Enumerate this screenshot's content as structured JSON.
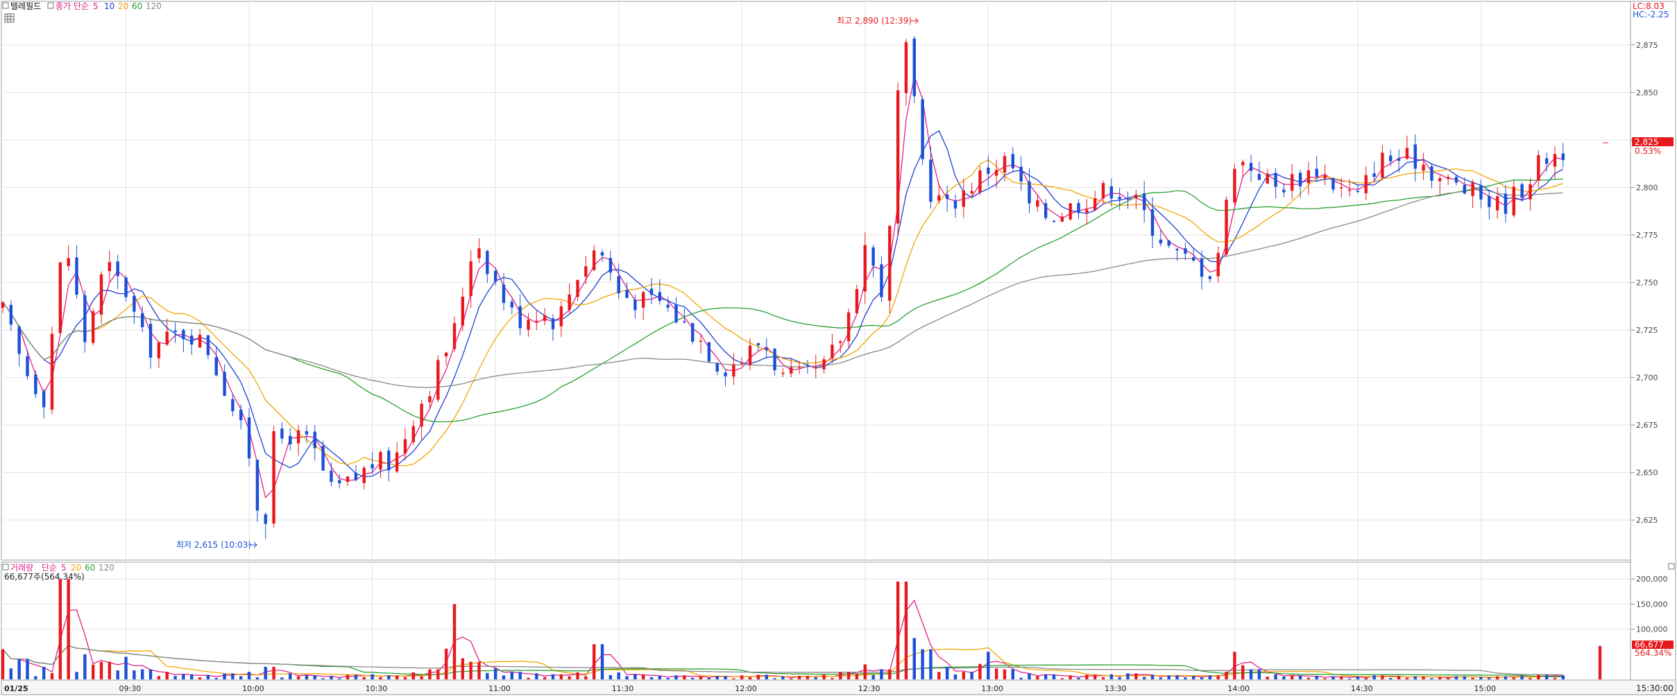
{
  "price_panel": {
    "title": "텔레필드",
    "indicator_label": "종가 단순",
    "ma_labels": [
      {
        "text": "5",
        "color": "#e0218a"
      },
      {
        "text": "10",
        "color": "#1f3fd1"
      },
      {
        "text": "20",
        "color": "#f2a500"
      },
      {
        "text": "60",
        "color": "#26a030"
      },
      {
        "text": "120",
        "color": "#888888"
      }
    ],
    "lc_label": "LC:8.03",
    "hc_label": "HC:-2.25",
    "high_annotation": "최고 2,890 (12:39)",
    "low_annotation": "최저 2,615 (10:03)",
    "current_price_tag": "2,825",
    "current_change_tag": "0.53%",
    "y_ticks": [
      "2,875",
      "2,850",
      "2,825",
      "2,800",
      "2,775",
      "2,750",
      "2,725",
      "2,700",
      "2,675",
      "2,650",
      "2,625"
    ]
  },
  "volume_panel": {
    "title": "거래량",
    "indicator_label": "단순",
    "ma_labels": [
      {
        "text": "5",
        "color": "#e0218a"
      },
      {
        "text": "20",
        "color": "#f2a500"
      },
      {
        "text": "60",
        "color": "#26a030"
      },
      {
        "text": "120",
        "color": "#888888"
      }
    ],
    "info_line": "66,677주(564.34%)",
    "current_volume_tag": "66,677",
    "current_ratio_tag": "564.34%",
    "y_ticks": [
      "200,000",
      "150,000",
      "100,000"
    ]
  },
  "x_axis": {
    "ticks": [
      "01/25",
      "09:30",
      "10:00",
      "10:30",
      "11:00",
      "11:30",
      "12:00",
      "12:30",
      "13:00",
      "13:30",
      "14:00",
      "14:30",
      "15:00"
    ],
    "end_label": "15:30:00"
  },
  "colors": {
    "up": "#e8191e",
    "down": "#1b4fd8",
    "ma5": "#e0218a",
    "ma10": "#1f3fd1",
    "ma20": "#f2a500",
    "ma60": "#26a030",
    "ma120": "#888888"
  },
  "chart_data": [
    {
      "type": "candlestick",
      "title": "텔레필드",
      "x_range": [
        "09:00",
        "15:30"
      ],
      "ylim": [
        2605,
        2895
      ],
      "grid": true,
      "price_points": [
        {
          "t": "09:00",
          "v": 2735
        },
        {
          "t": "09:05",
          "v": 2705
        },
        {
          "t": "09:10",
          "v": 2690
        },
        {
          "t": "09:15",
          "v": 2775
        },
        {
          "t": "09:20",
          "v": 2720
        },
        {
          "t": "09:25",
          "v": 2760
        },
        {
          "t": "09:30",
          "v": 2745
        },
        {
          "t": "09:35",
          "v": 2715
        },
        {
          "t": "09:40",
          "v": 2720
        },
        {
          "t": "09:45",
          "v": 2725
        },
        {
          "t": "09:50",
          "v": 2715
        },
        {
          "t": "09:55",
          "v": 2690
        },
        {
          "t": "10:00",
          "v": 2660
        },
        {
          "t": "10:03",
          "v": 2620
        },
        {
          "t": "10:05",
          "v": 2665
        },
        {
          "t": "10:10",
          "v": 2670
        },
        {
          "t": "10:15",
          "v": 2665
        },
        {
          "t": "10:20",
          "v": 2640
        },
        {
          "t": "10:25",
          "v": 2645
        },
        {
          "t": "10:30",
          "v": 2655
        },
        {
          "t": "10:35",
          "v": 2655
        },
        {
          "t": "10:40",
          "v": 2680
        },
        {
          "t": "10:45",
          "v": 2700
        },
        {
          "t": "10:50",
          "v": 2725
        },
        {
          "t": "10:55",
          "v": 2775
        },
        {
          "t": "11:00",
          "v": 2750
        },
        {
          "t": "11:05",
          "v": 2730
        },
        {
          "t": "11:10",
          "v": 2735
        },
        {
          "t": "11:15",
          "v": 2730
        },
        {
          "t": "11:20",
          "v": 2755
        },
        {
          "t": "11:25",
          "v": 2770
        },
        {
          "t": "11:30",
          "v": 2745
        },
        {
          "t": "11:35",
          "v": 2740
        },
        {
          "t": "11:40",
          "v": 2740
        },
        {
          "t": "11:45",
          "v": 2730
        },
        {
          "t": "11:50",
          "v": 2720
        },
        {
          "t": "11:55",
          "v": 2705
        },
        {
          "t": "12:00",
          "v": 2710
        },
        {
          "t": "12:05",
          "v": 2720
        },
        {
          "t": "12:10",
          "v": 2700
        },
        {
          "t": "12:15",
          "v": 2700
        },
        {
          "t": "12:20",
          "v": 2705
        },
        {
          "t": "12:25",
          "v": 2725
        },
        {
          "t": "12:30",
          "v": 2770
        },
        {
          "t": "12:35",
          "v": 2740
        },
        {
          "t": "12:39",
          "v": 2885
        },
        {
          "t": "12:45",
          "v": 2800
        },
        {
          "t": "12:50",
          "v": 2790
        },
        {
          "t": "12:55",
          "v": 2800
        },
        {
          "t": "13:00",
          "v": 2810
        },
        {
          "t": "13:05",
          "v": 2815
        },
        {
          "t": "13:10",
          "v": 2790
        },
        {
          "t": "13:15",
          "v": 2785
        },
        {
          "t": "13:20",
          "v": 2790
        },
        {
          "t": "13:25",
          "v": 2795
        },
        {
          "t": "13:30",
          "v": 2800
        },
        {
          "t": "13:35",
          "v": 2795
        },
        {
          "t": "13:40",
          "v": 2780
        },
        {
          "t": "13:45",
          "v": 2765
        },
        {
          "t": "13:50",
          "v": 2760
        },
        {
          "t": "13:55",
          "v": 2755
        },
        {
          "t": "14:00",
          "v": 2815
        },
        {
          "t": "14:05",
          "v": 2810
        },
        {
          "t": "14:10",
          "v": 2800
        },
        {
          "t": "14:15",
          "v": 2805
        },
        {
          "t": "14:20",
          "v": 2810
        },
        {
          "t": "14:25",
          "v": 2800
        },
        {
          "t": "14:30",
          "v": 2795
        },
        {
          "t": "14:35",
          "v": 2815
        },
        {
          "t": "14:40",
          "v": 2815
        },
        {
          "t": "14:45",
          "v": 2815
        },
        {
          "t": "14:50",
          "v": 2805
        },
        {
          "t": "14:55",
          "v": 2800
        },
        {
          "t": "15:00",
          "v": 2795
        },
        {
          "t": "15:05",
          "v": 2790
        },
        {
          "t": "15:10",
          "v": 2800
        },
        {
          "t": "15:15",
          "v": 2815
        },
        {
          "t": "15:20",
          "v": 2820
        }
      ],
      "high": {
        "value": 2890,
        "time": "12:39"
      },
      "low": {
        "value": 2615,
        "time": "10:03"
      },
      "last": 2825,
      "change_pct": 0.53
    },
    {
      "type": "bar",
      "title": "거래량",
      "ylim": [
        0,
        210000
      ],
      "volume_points": [
        {
          "t": "09:00",
          "v": 60000
        },
        {
          "t": "09:05",
          "v": 40000
        },
        {
          "t": "09:10",
          "v": 25000
        },
        {
          "t": "09:15",
          "v": 200000
        },
        {
          "t": "09:20",
          "v": 50000
        },
        {
          "t": "09:25",
          "v": 35000
        },
        {
          "t": "09:30",
          "v": 45000
        },
        {
          "t": "09:35",
          "v": 20000
        },
        {
          "t": "09:40",
          "v": 15000
        },
        {
          "t": "09:45",
          "v": 10000
        },
        {
          "t": "09:50",
          "v": 9000
        },
        {
          "t": "09:55",
          "v": 12000
        },
        {
          "t": "10:00",
          "v": 15000
        },
        {
          "t": "10:05",
          "v": 25000
        },
        {
          "t": "10:10",
          "v": 12000
        },
        {
          "t": "10:15",
          "v": 8000
        },
        {
          "t": "10:20",
          "v": 7000
        },
        {
          "t": "10:25",
          "v": 9000
        },
        {
          "t": "10:30",
          "v": 10000
        },
        {
          "t": "10:35",
          "v": 8000
        },
        {
          "t": "10:40",
          "v": 14000
        },
        {
          "t": "10:45",
          "v": 20000
        },
        {
          "t": "10:50",
          "v": 150000
        },
        {
          "t": "10:55",
          "v": 35000
        },
        {
          "t": "11:00",
          "v": 22000
        },
        {
          "t": "11:05",
          "v": 15000
        },
        {
          "t": "11:10",
          "v": 12000
        },
        {
          "t": "11:15",
          "v": 10000
        },
        {
          "t": "11:20",
          "v": 14000
        },
        {
          "t": "11:25",
          "v": 70000
        },
        {
          "t": "11:30",
          "v": 14000
        },
        {
          "t": "11:35",
          "v": 10000
        },
        {
          "t": "11:40",
          "v": 7000
        },
        {
          "t": "11:45",
          "v": 8000
        },
        {
          "t": "11:50",
          "v": 6000
        },
        {
          "t": "11:55",
          "v": 7000
        },
        {
          "t": "12:00",
          "v": 8000
        },
        {
          "t": "12:05",
          "v": 9000
        },
        {
          "t": "12:10",
          "v": 6000
        },
        {
          "t": "12:15",
          "v": 7000
        },
        {
          "t": "12:20",
          "v": 9000
        },
        {
          "t": "12:25",
          "v": 15000
        },
        {
          "t": "12:30",
          "v": 30000
        },
        {
          "t": "12:35",
          "v": 20000
        },
        {
          "t": "12:39",
          "v": 195000
        },
        {
          "t": "12:45",
          "v": 60000
        },
        {
          "t": "12:50",
          "v": 25000
        },
        {
          "t": "12:55",
          "v": 15000
        },
        {
          "t": "13:00",
          "v": 55000
        },
        {
          "t": "13:05",
          "v": 20000
        },
        {
          "t": "13:10",
          "v": 12000
        },
        {
          "t": "13:15",
          "v": 10000
        },
        {
          "t": "13:20",
          "v": 8000
        },
        {
          "t": "13:25",
          "v": 9000
        },
        {
          "t": "13:30",
          "v": 10000
        },
        {
          "t": "13:35",
          "v": 12000
        },
        {
          "t": "13:40",
          "v": 9000
        },
        {
          "t": "13:45",
          "v": 8000
        },
        {
          "t": "13:50",
          "v": 7000
        },
        {
          "t": "13:55",
          "v": 8000
        },
        {
          "t": "14:00",
          "v": 55000
        },
        {
          "t": "14:05",
          "v": 20000
        },
        {
          "t": "14:10",
          "v": 10000
        },
        {
          "t": "14:15",
          "v": 8000
        },
        {
          "t": "14:20",
          "v": 7000
        },
        {
          "t": "14:25",
          "v": 6000
        },
        {
          "t": "14:30",
          "v": 6000
        },
        {
          "t": "14:35",
          "v": 8000
        },
        {
          "t": "14:40",
          "v": 7000
        },
        {
          "t": "14:45",
          "v": 6000
        },
        {
          "t": "14:50",
          "v": 5000
        },
        {
          "t": "14:55",
          "v": 6000
        },
        {
          "t": "15:00",
          "v": 5000
        },
        {
          "t": "15:05",
          "v": 6000
        },
        {
          "t": "15:10",
          "v": 7000
        },
        {
          "t": "15:15",
          "v": 9000
        },
        {
          "t": "15:20",
          "v": 8000
        },
        {
          "t": "15:30",
          "v": 66677
        }
      ],
      "last": 66677,
      "ratio_pct": 564.34
    }
  ]
}
